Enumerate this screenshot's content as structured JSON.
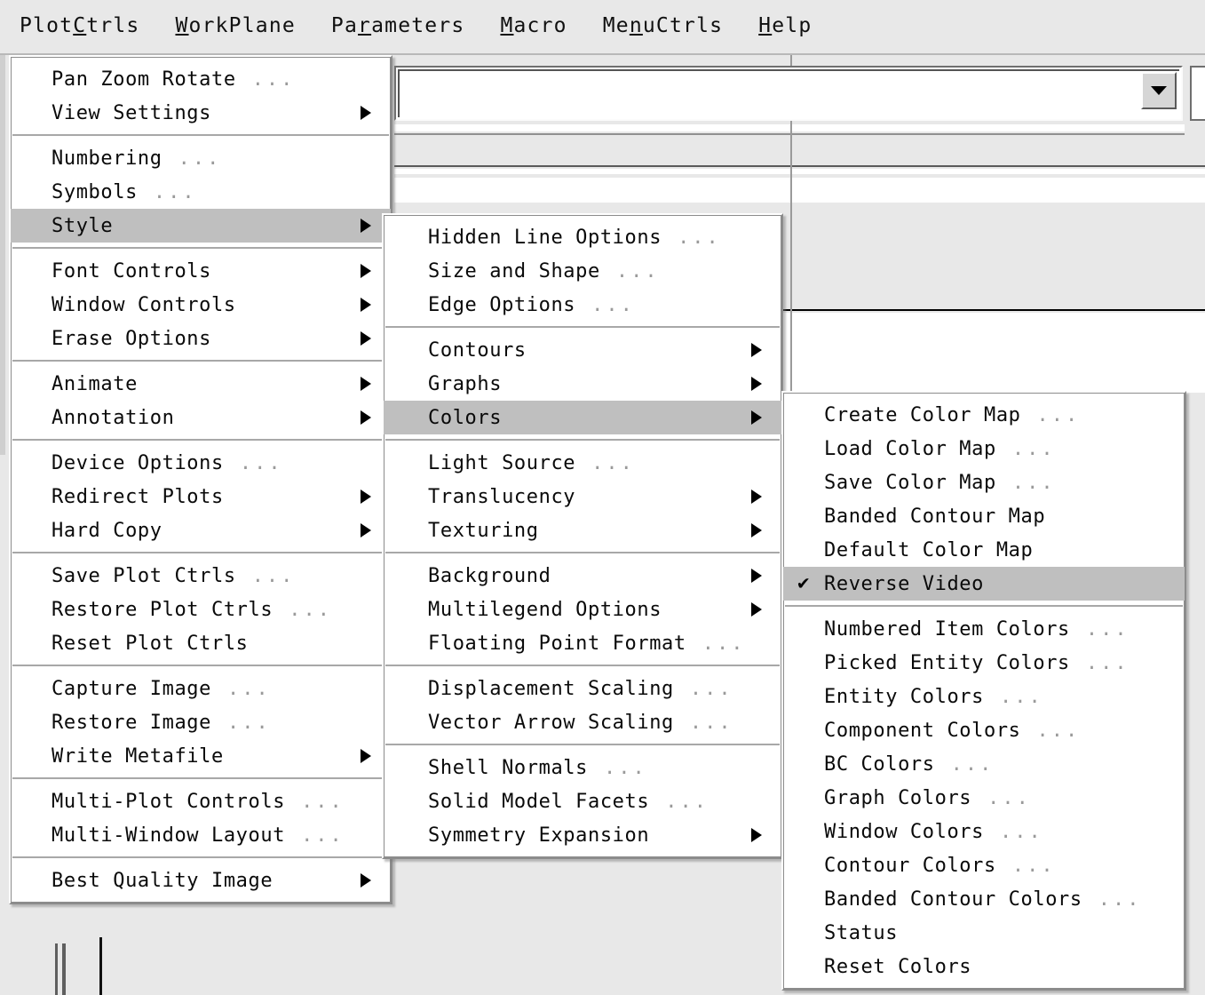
{
  "window": {
    "background_color": "#e8e8e8",
    "highlight_color": "#bfbfbf",
    "text_color": "#0a0a0a",
    "menu_background": "#ffffff"
  },
  "menubar": {
    "items": [
      {
        "label": "PlotCtrls",
        "pre": "Plot",
        "mnemonic": "C",
        "post": "trls"
      },
      {
        "label": "WorkPlane",
        "pre": "",
        "mnemonic": "W",
        "post": "orkPlane"
      },
      {
        "label": "Parameters",
        "pre": "Pa",
        "mnemonic": "r",
        "post": "ameters"
      },
      {
        "label": "Macro",
        "pre": "",
        "mnemonic": "M",
        "post": "acro"
      },
      {
        "label": "MenuCtrls",
        "pre": "Me",
        "mnemonic": "n",
        "post": "uCtrls"
      },
      {
        "label": "Help",
        "pre": "",
        "mnemonic": "H",
        "post": "elp"
      }
    ]
  },
  "combo": {
    "value": "",
    "arrow_icon": "chevron-down-icon"
  },
  "menu_plotctrls": {
    "name": "PlotCtrls",
    "groups": [
      {
        "items": [
          {
            "label": "Pan Zoom Rotate",
            "ellipsis": "...",
            "arrow": false,
            "highlighted": false
          },
          {
            "label": "View Settings",
            "ellipsis": "",
            "arrow": true,
            "highlighted": false
          }
        ]
      },
      {
        "items": [
          {
            "label": "Numbering",
            "ellipsis": "...",
            "arrow": false,
            "highlighted": false
          },
          {
            "label": "Symbols",
            "ellipsis": "...",
            "arrow": false,
            "highlighted": false
          },
          {
            "label": "Style",
            "ellipsis": "",
            "arrow": true,
            "highlighted": true
          }
        ]
      },
      {
        "items": [
          {
            "label": "Font Controls",
            "ellipsis": "",
            "arrow": true,
            "highlighted": false
          },
          {
            "label": "Window Controls",
            "ellipsis": "",
            "arrow": true,
            "highlighted": false
          },
          {
            "label": "Erase Options",
            "ellipsis": "",
            "arrow": true,
            "highlighted": false
          }
        ]
      },
      {
        "items": [
          {
            "label": "Animate",
            "ellipsis": "",
            "arrow": true,
            "highlighted": false
          },
          {
            "label": "Annotation",
            "ellipsis": "",
            "arrow": true,
            "highlighted": false
          }
        ]
      },
      {
        "items": [
          {
            "label": "Device Options",
            "ellipsis": "...",
            "arrow": false,
            "highlighted": false
          },
          {
            "label": "Redirect Plots",
            "ellipsis": "",
            "arrow": true,
            "highlighted": false
          },
          {
            "label": "Hard Copy",
            "ellipsis": "",
            "arrow": true,
            "highlighted": false
          }
        ]
      },
      {
        "items": [
          {
            "label": "Save Plot Ctrls",
            "ellipsis": "...",
            "arrow": false,
            "highlighted": false
          },
          {
            "label": "Restore Plot Ctrls",
            "ellipsis": "...",
            "arrow": false,
            "highlighted": false
          },
          {
            "label": "Reset Plot Ctrls",
            "ellipsis": "",
            "arrow": false,
            "highlighted": false
          }
        ]
      },
      {
        "items": [
          {
            "label": "Capture Image",
            "ellipsis": "...",
            "arrow": false,
            "highlighted": false
          },
          {
            "label": "Restore Image",
            "ellipsis": "...",
            "arrow": false,
            "highlighted": false
          },
          {
            "label": "Write Metafile",
            "ellipsis": "",
            "arrow": true,
            "highlighted": false
          }
        ]
      },
      {
        "items": [
          {
            "label": "Multi-Plot Controls",
            "ellipsis": "...",
            "arrow": false,
            "highlighted": false
          },
          {
            "label": "Multi-Window Layout",
            "ellipsis": "...",
            "arrow": false,
            "highlighted": false
          }
        ]
      },
      {
        "items": [
          {
            "label": "Best Quality Image",
            "ellipsis": "",
            "arrow": true,
            "highlighted": false
          }
        ]
      }
    ]
  },
  "menu_style": {
    "name": "Style",
    "groups": [
      {
        "items": [
          {
            "label": "Hidden Line Options",
            "ellipsis": "...",
            "arrow": false,
            "highlighted": false
          },
          {
            "label": "Size and Shape",
            "ellipsis": "...",
            "arrow": false,
            "highlighted": false
          },
          {
            "label": "Edge Options",
            "ellipsis": "...",
            "arrow": false,
            "highlighted": false
          }
        ]
      },
      {
        "items": [
          {
            "label": "Contours",
            "ellipsis": "",
            "arrow": true,
            "highlighted": false
          },
          {
            "label": "Graphs",
            "ellipsis": "",
            "arrow": true,
            "highlighted": false
          },
          {
            "label": "Colors",
            "ellipsis": "",
            "arrow": true,
            "highlighted": true
          }
        ]
      },
      {
        "items": [
          {
            "label": "Light Source",
            "ellipsis": "...",
            "arrow": false,
            "highlighted": false
          },
          {
            "label": "Translucency",
            "ellipsis": "",
            "arrow": true,
            "highlighted": false
          },
          {
            "label": "Texturing",
            "ellipsis": "",
            "arrow": true,
            "highlighted": false
          }
        ]
      },
      {
        "items": [
          {
            "label": "Background",
            "ellipsis": "",
            "arrow": true,
            "highlighted": false
          },
          {
            "label": "Multilegend Options",
            "ellipsis": "",
            "arrow": true,
            "highlighted": false
          },
          {
            "label": "Floating Point Format",
            "ellipsis": "...",
            "arrow": false,
            "highlighted": false
          }
        ]
      },
      {
        "items": [
          {
            "label": "Displacement Scaling",
            "ellipsis": "...",
            "arrow": false,
            "highlighted": false
          },
          {
            "label": "Vector Arrow Scaling",
            "ellipsis": "...",
            "arrow": false,
            "highlighted": false
          }
        ]
      },
      {
        "items": [
          {
            "label": "Shell Normals",
            "ellipsis": "...",
            "arrow": false,
            "highlighted": false
          },
          {
            "label": "Solid Model Facets",
            "ellipsis": "...",
            "arrow": false,
            "highlighted": false
          },
          {
            "label": "Symmetry Expansion",
            "ellipsis": "",
            "arrow": true,
            "highlighted": false
          }
        ]
      }
    ]
  },
  "menu_colors": {
    "name": "Colors",
    "groups": [
      {
        "items": [
          {
            "label": "Create Color Map",
            "ellipsis": "...",
            "arrow": false,
            "highlighted": false,
            "checked": false
          },
          {
            "label": "Load Color Map",
            "ellipsis": "...",
            "arrow": false,
            "highlighted": false,
            "checked": false
          },
          {
            "label": "Save Color Map",
            "ellipsis": "...",
            "arrow": false,
            "highlighted": false,
            "checked": false
          },
          {
            "label": "Banded Contour Map",
            "ellipsis": "",
            "arrow": false,
            "highlighted": false,
            "checked": false
          },
          {
            "label": "Default Color Map",
            "ellipsis": "",
            "arrow": false,
            "highlighted": false,
            "checked": false
          },
          {
            "label": "Reverse Video",
            "ellipsis": "",
            "arrow": false,
            "highlighted": true,
            "checked": true
          }
        ]
      },
      {
        "items": [
          {
            "label": "Numbered Item Colors",
            "ellipsis": "...",
            "arrow": false,
            "highlighted": false,
            "checked": false
          },
          {
            "label": "Picked Entity Colors",
            "ellipsis": "...",
            "arrow": false,
            "highlighted": false,
            "checked": false
          },
          {
            "label": "Entity Colors",
            "ellipsis": "...",
            "arrow": false,
            "highlighted": false,
            "checked": false
          },
          {
            "label": "Component Colors",
            "ellipsis": "...",
            "arrow": false,
            "highlighted": false,
            "checked": false
          },
          {
            "label": "BC Colors",
            "ellipsis": "...",
            "arrow": false,
            "highlighted": false,
            "checked": false
          },
          {
            "label": "Graph Colors",
            "ellipsis": "...",
            "arrow": false,
            "highlighted": false,
            "checked": false
          },
          {
            "label": "Window Colors",
            "ellipsis": "...",
            "arrow": false,
            "highlighted": false,
            "checked": false
          },
          {
            "label": "Contour Colors",
            "ellipsis": "...",
            "arrow": false,
            "highlighted": false,
            "checked": false
          },
          {
            "label": "Banded Contour Colors",
            "ellipsis": "...",
            "arrow": false,
            "highlighted": false,
            "checked": false
          },
          {
            "label": "Status",
            "ellipsis": "",
            "arrow": false,
            "highlighted": false,
            "checked": false
          },
          {
            "label": "Reset Colors",
            "ellipsis": "",
            "arrow": false,
            "highlighted": false,
            "checked": false
          }
        ]
      }
    ]
  },
  "icons": {
    "submenu_arrow": "chevron-right-icon",
    "check": "check-icon",
    "dropdown": "chevron-down-icon"
  }
}
